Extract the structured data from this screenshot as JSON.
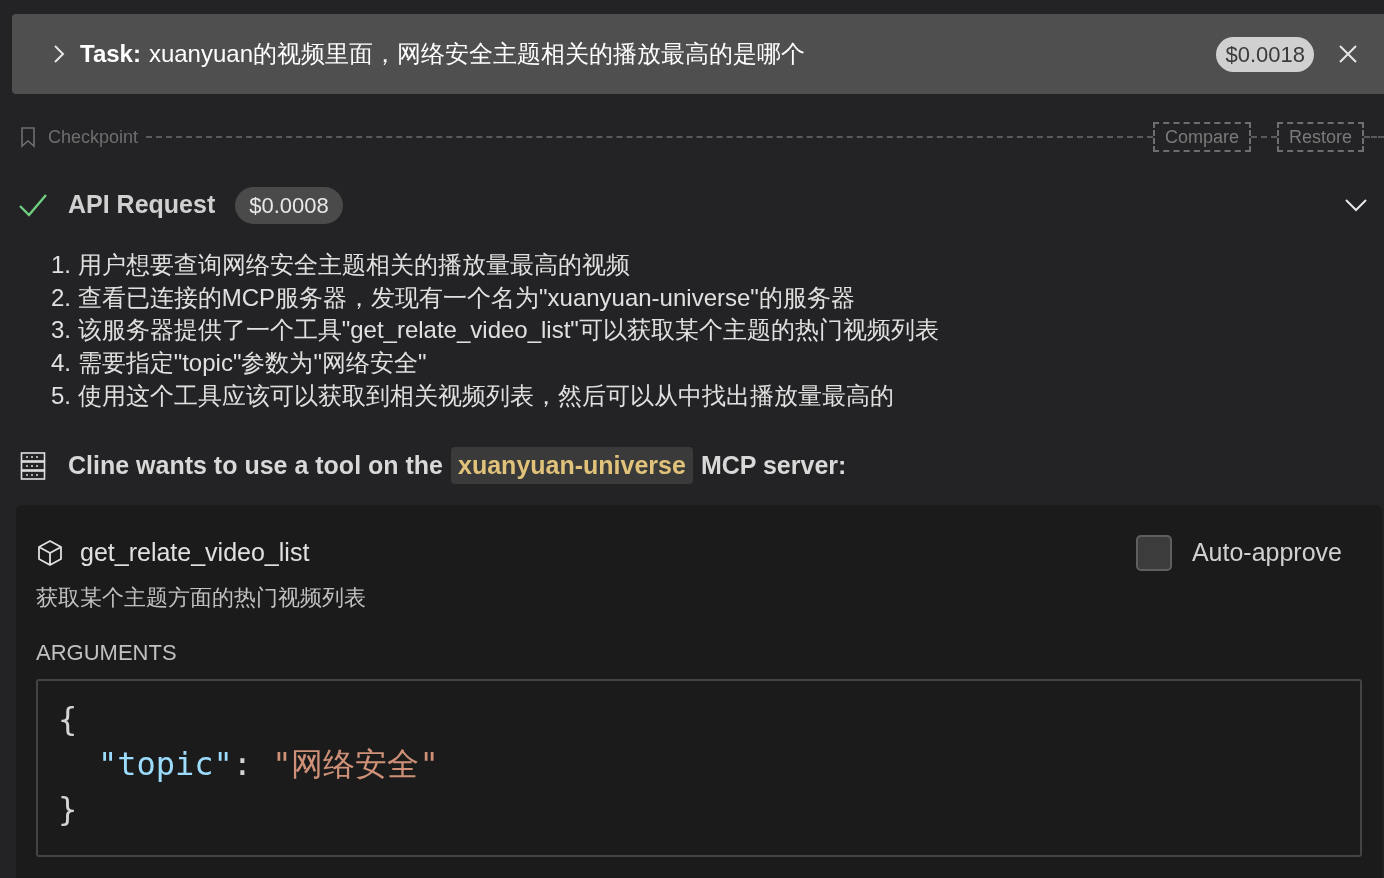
{
  "task": {
    "label": "Task:",
    "text": "xuanyuan的视频里面，网络安全主题相关的播放最高的是哪个",
    "cost": "$0.0018",
    "expanded": false
  },
  "checkpoint": {
    "label": "Checkpoint",
    "actions": [
      "Compare",
      "Restore"
    ]
  },
  "api_request": {
    "title": "API Request",
    "cost": "$0.0008",
    "done": true,
    "expanded": true
  },
  "steps": [
    "1. 用户想要查询网络安全主题相关的播放量最高的视频",
    "2. 查看已连接的MCP服务器，发现有一个名为\"xuanyuan-universe\"的服务器",
    "3. 该服务器提供了一个工具\"get_relate_video_list\"可以获取某个主题的热门视频列表",
    "4. 需要指定\"topic\"参数为\"网络安全\"",
    "5. 使用这个工具应该可以获取到相关视频列表，然后可以从中找出播放量最高的"
  ],
  "tool_request": {
    "prefix": "Cline wants to use a tool on the",
    "server": "xuanyuan-universe",
    "suffix": "MCP server:"
  },
  "tool": {
    "name": "get_relate_video_list",
    "description": "获取某个主题方面的热门视频列表",
    "auto_approve": {
      "label": "Auto-approve",
      "checked": false
    },
    "arguments_label": "ARGUMENTS",
    "arguments": {
      "open": "{",
      "close": "}",
      "entries": [
        {
          "key": "\"topic\"",
          "separator": ":",
          "value": "\"网络安全\""
        }
      ]
    }
  }
}
